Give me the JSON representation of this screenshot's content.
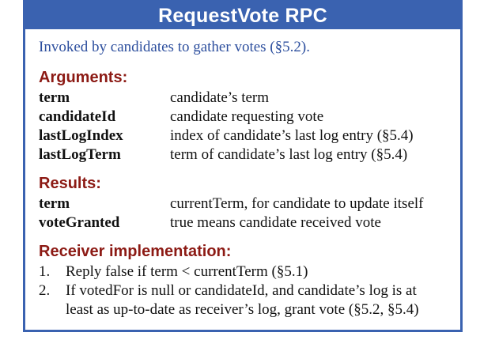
{
  "title": "RequestVote RPC",
  "intro": "Invoked by candidates to gather votes (§5.2).",
  "arguments": {
    "heading": "Arguments:",
    "items": [
      {
        "name": "term",
        "desc": "candidate’s term"
      },
      {
        "name": "candidateId",
        "desc": "candidate requesting vote"
      },
      {
        "name": "lastLogIndex",
        "desc": "index of candidate’s last log entry (§5.4)"
      },
      {
        "name": "lastLogTerm",
        "desc": "term of candidate’s last log entry (§5.4)"
      }
    ]
  },
  "results": {
    "heading": "Results:",
    "items": [
      {
        "name": "term",
        "desc": "currentTerm, for candidate to update itself"
      },
      {
        "name": "voteGranted",
        "desc": "true means candidate received vote"
      }
    ]
  },
  "receiver": {
    "heading": "Receiver implementation:",
    "steps": [
      {
        "num": "1.",
        "text": "Reply false if term < currentTerm (§5.1)"
      },
      {
        "num": "2.",
        "text": "If votedFor is null or candidateId, and candidate’s log is at least as up-to-date as receiver’s log, grant vote (§5.2, §5.4)"
      }
    ]
  },
  "colors": {
    "frame": "#3a62b0",
    "heading": "#8c1a14",
    "intro": "#2d4f9e"
  }
}
